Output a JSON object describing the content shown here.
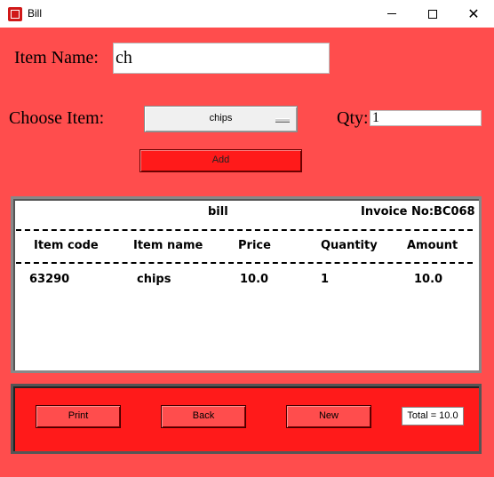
{
  "window": {
    "title": "Bill",
    "app_icon": "tkinter-app-icon"
  },
  "titlebar_controls": {
    "minimize_icon": "minimize-icon",
    "maximize_icon": "maximize-icon",
    "close_icon": "close-icon",
    "close_glyph": "✕"
  },
  "form": {
    "item_name_label": "Item Name:",
    "item_name_value": "ch",
    "choose_item_label": "Choose Item:",
    "choose_item_selected": "chips",
    "qty_label": "Qty:",
    "qty_value": "1",
    "add_label": "Add"
  },
  "bill": {
    "title": "bill",
    "invoice": "Invoice No:BC068",
    "columns": [
      "Item code",
      "Item name",
      "Price",
      "Quantity",
      "Amount"
    ],
    "rows": [
      {
        "code": "63290",
        "name": "chips",
        "price": "10.0",
        "qty": "1",
        "amount": "10.0"
      }
    ]
  },
  "actions": {
    "print": "Print",
    "back": "Back",
    "new": "New"
  },
  "total": "Total = 10.0",
  "colors": {
    "background": "#ff4d4d",
    "button_red": "#ff1a1a",
    "white": "#ffffff"
  }
}
